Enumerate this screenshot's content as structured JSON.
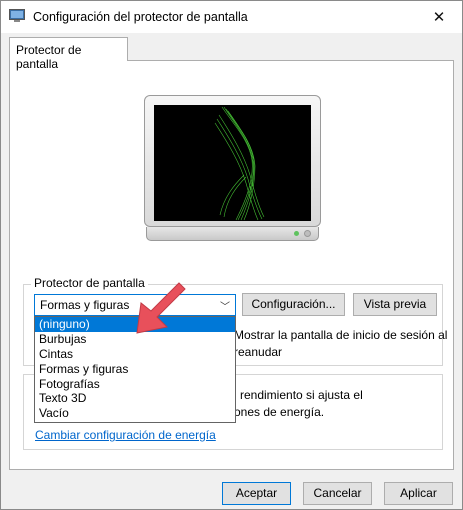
{
  "window": {
    "title": "Configuración del protector de pantalla"
  },
  "tabs": [
    {
      "label": "Protector de pantalla"
    }
  ],
  "screensaver": {
    "group_label": "Protector de pantalla",
    "selected_value": "Formas y figuras",
    "settings_button": "Configuración...",
    "preview_button": "Vista previa",
    "options": [
      "(ninguno)",
      "Burbujas",
      "Cintas",
      "Formas y figuras",
      "Fotografías",
      "Texto 3D",
      "Vacío"
    ],
    "highlighted_option": "(ninguno)",
    "resume_text_line1": "Mostrar la pantalla de inicio de sesión al",
    "resume_text_line2": "reanudar"
  },
  "power": {
    "text_line1": "l rendimiento si ajusta el",
    "text_line2": "ones de energía.",
    "link": "Cambiar configuración de energía"
  },
  "footer": {
    "ok": "Aceptar",
    "cancel": "Cancelar",
    "apply": "Aplicar"
  },
  "colors": {
    "accent": "#0078d7",
    "arrow": "#e8505b",
    "screensaver_line": "#4cd23a"
  },
  "icons": [
    "screensaver-settings-icon",
    "close-icon",
    "chevron-down-icon",
    "red-arrow-icon"
  ]
}
